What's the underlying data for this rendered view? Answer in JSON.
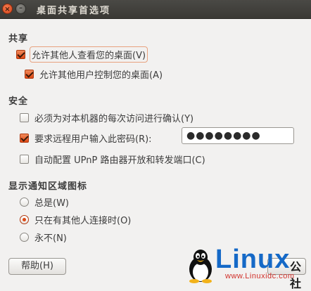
{
  "window": {
    "title": "桌面共享首选项",
    "close_glyph": "×",
    "minimize_glyph": "–"
  },
  "sharing": {
    "heading": "共享",
    "allow_view": {
      "label": "允许其他人查看您的桌面(V)",
      "checked": true
    },
    "allow_control": {
      "label": "允许其他用户控制您的桌面(A)",
      "checked": true
    }
  },
  "security": {
    "heading": "安全",
    "confirm_each": {
      "label": "必须为对本机器的每次访问进行确认(Y)",
      "checked": false
    },
    "require_password": {
      "label": "要求远程用户输入此密码(R):",
      "checked": true
    },
    "password_value": "●●●●●●●●",
    "upnp": {
      "label": "自动配置 UPnP 路由器开放和转发端口(C)",
      "checked": false
    }
  },
  "notification": {
    "heading": "显示通知区域图标",
    "options": [
      {
        "label": "总是(W)",
        "selected": false
      },
      {
        "label": "只在有其他人连接时(O)",
        "selected": true
      },
      {
        "label": "永不(N)",
        "selected": false
      }
    ]
  },
  "buttons": {
    "help_label": "帮助(H)"
  },
  "watermark": {
    "brand": "Linux",
    "brand_suffix": "公社",
    "url": "www.Linuxidc.com"
  }
}
